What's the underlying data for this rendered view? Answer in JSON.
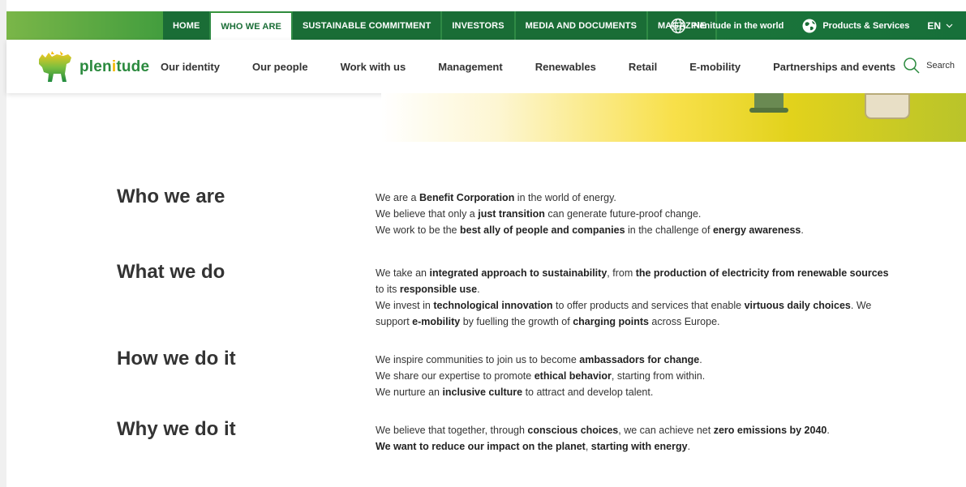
{
  "top_nav": {
    "tabs": [
      {
        "label": "HOME"
      },
      {
        "label": "WHO WE ARE"
      },
      {
        "label": "SUSTAINABLE COMMITMENT"
      },
      {
        "label": "INVESTORS"
      },
      {
        "label": "MEDIA AND DOCUMENTS"
      },
      {
        "label": "MAGAZINE"
      }
    ],
    "active_tab": "WHO WE ARE",
    "world_link": "Plenitude in the world",
    "products_link": "Products & Services",
    "language": "EN"
  },
  "logo": {
    "text_pre": "plen",
    "text_dot": "i",
    "text_post": "tude"
  },
  "main_nav": {
    "items": [
      {
        "label": "Our identity"
      },
      {
        "label": "Our people"
      },
      {
        "label": "Work with us"
      },
      {
        "label": "Management"
      },
      {
        "label": "Renewables"
      },
      {
        "label": "Retail"
      },
      {
        "label": "E-mobility"
      },
      {
        "label": "Partnerships and events"
      }
    ],
    "search_label": "Search"
  },
  "sections": [
    {
      "title": "Who we are",
      "lines": [
        [
          {
            "t": "We are a "
          },
          {
            "t": "Benefit Corporation",
            "b": true
          },
          {
            "t": " in the world of energy."
          }
        ],
        [
          {
            "t": "We believe that only a "
          },
          {
            "t": "just transition",
            "b": true
          },
          {
            "t": " can generate future-proof change."
          }
        ],
        [
          {
            "t": "We work to be the "
          },
          {
            "t": "best ally of people and companies",
            "b": true
          },
          {
            "t": " in the challenge of "
          },
          {
            "t": "energy awareness",
            "b": true
          },
          {
            "t": "."
          }
        ]
      ]
    },
    {
      "title": "What we do",
      "lines": [
        [
          {
            "t": "We take an "
          },
          {
            "t": "integrated approach to sustainability",
            "b": true
          },
          {
            "t": ", from "
          },
          {
            "t": "the production of electricity from renewable sources",
            "b": true
          }
        ],
        [
          {
            "t": "to its "
          },
          {
            "t": "responsible use",
            "b": true
          },
          {
            "t": "."
          }
        ],
        [
          {
            "t": "We invest in "
          },
          {
            "t": "technological innovation",
            "b": true
          },
          {
            "t": " to offer products and services that enable "
          },
          {
            "t": "virtuous daily choices",
            "b": true
          },
          {
            "t": ". We"
          }
        ],
        [
          {
            "t": "support "
          },
          {
            "t": "e-mobility",
            "b": true
          },
          {
            "t": " by fuelling the growth of "
          },
          {
            "t": "charging points",
            "b": true
          },
          {
            "t": " across Europe."
          }
        ]
      ]
    },
    {
      "title": "How we do it",
      "lines": [
        [
          {
            "t": "We inspire communities to join us to become "
          },
          {
            "t": "ambassadors for change",
            "b": true
          },
          {
            "t": "."
          }
        ],
        [
          {
            "t": "We share our expertise to promote "
          },
          {
            "t": "ethical behavior",
            "b": true
          },
          {
            "t": ", starting from within."
          }
        ],
        [
          {
            "t": "We nurture an "
          },
          {
            "t": "inclusive culture",
            "b": true
          },
          {
            "t": " to attract and develop talent."
          }
        ]
      ]
    },
    {
      "title": "Why we do it",
      "lines": [
        [
          {
            "t": "We believe that together, through "
          },
          {
            "t": "conscious choices",
            "b": true
          },
          {
            "t": ", we can achieve net "
          },
          {
            "t": "zero emissions by 2040",
            "b": true
          },
          {
            "t": "."
          }
        ],
        [
          {
            "t": "We want to reduce our impact on the planet",
            "b": true
          },
          {
            "t": ", "
          },
          {
            "t": "starting with energy",
            "b": true
          },
          {
            "t": "."
          }
        ]
      ]
    }
  ],
  "colors": {
    "brand_green": "#1a6d36",
    "logo_green": "#2b8a3e",
    "logo_yellow": "#f2b705",
    "text": "#333333"
  },
  "icons": [
    "globe-icon",
    "globe-arrows-icon",
    "chevron-down-icon",
    "search-icon",
    "dog-logo-icon"
  ]
}
